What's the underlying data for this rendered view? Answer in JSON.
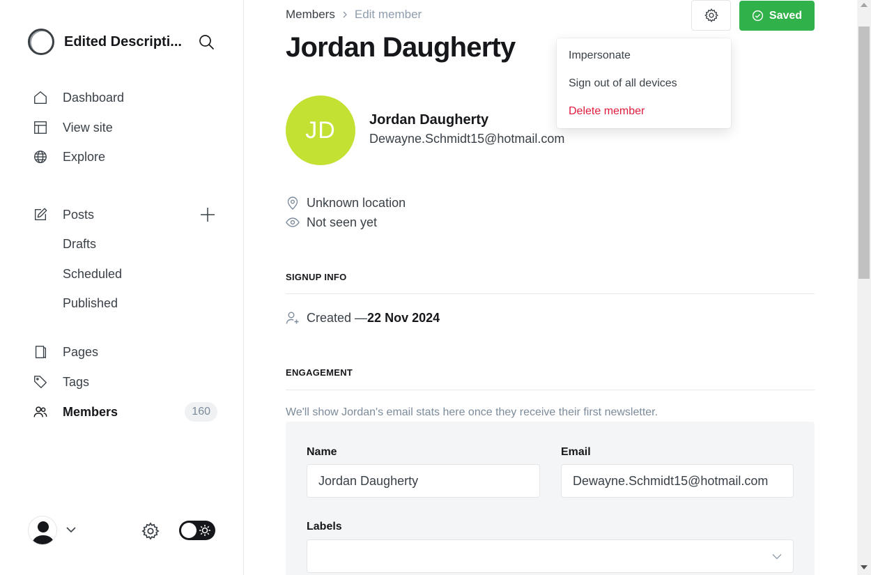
{
  "sidebar": {
    "site_title": "Edited Descripti...",
    "nav": {
      "dashboard": "Dashboard",
      "view_site": "View site",
      "explore": "Explore",
      "posts": "Posts",
      "drafts": "Drafts",
      "scheduled": "Scheduled",
      "published": "Published",
      "pages": "Pages",
      "tags": "Tags",
      "members": "Members",
      "members_count": "160"
    }
  },
  "breadcrumb": {
    "parent": "Members",
    "current": "Edit member"
  },
  "page_title": "Jordan Daugherty",
  "actions": {
    "saved_label": "Saved"
  },
  "settings_menu": {
    "items": [
      "Impersonate",
      "Sign out of all devices",
      "Delete member"
    ]
  },
  "member": {
    "initials": "JD",
    "avatar_color": "#c2e132",
    "name": "Jordan Daugherty",
    "email": "Dewayne.Schmidt15@hotmail.com",
    "location": "Unknown location",
    "last_seen": "Not seen yet"
  },
  "signup": {
    "heading": "SIGNUP INFO",
    "created_prefix": "Created — ",
    "created_date": "22 Nov 2024"
  },
  "engagement": {
    "heading": "ENGAGEMENT",
    "note": "We'll show Jordan's email stats here once they receive their first newsletter."
  },
  "form": {
    "name_label": "Name",
    "name_value": "Jordan Daugherty",
    "email_label": "Email",
    "email_value": "Dewayne.Schmidt15@hotmail.com",
    "labels_label": "Labels",
    "labels_value": ""
  },
  "colors": {
    "saved_green": "#30b14a",
    "danger_red": "#e01c3c",
    "avatar_lime": "#c2e132"
  }
}
